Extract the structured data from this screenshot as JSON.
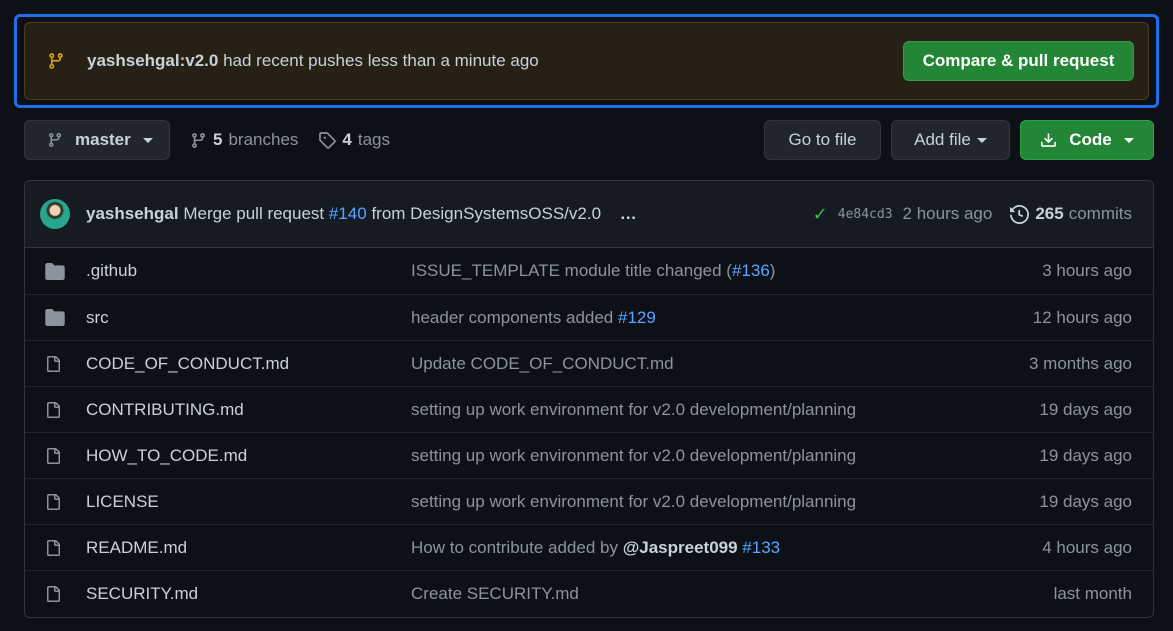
{
  "banner": {
    "branch": "yashsehgal:v2.0",
    "message": "had recent pushes less than a minute ago",
    "button": "Compare & pull request"
  },
  "toolbar": {
    "branch": "master",
    "branches_count": "5",
    "branches_label": "branches",
    "tags_count": "4",
    "tags_label": "tags",
    "goto_file": "Go to file",
    "add_file": "Add file",
    "code": "Code"
  },
  "commit": {
    "author": "yashsehgal",
    "msg_pre": "Merge pull request",
    "pr": "#140",
    "msg_post": "from DesignSystemsOSS/v2.0",
    "more": "…",
    "sha": "4e84cd3",
    "time": "2 hours ago",
    "commits_count": "265",
    "commits_label": "commits"
  },
  "files": [
    {
      "name": ".github",
      "type": "folder",
      "msg": "ISSUE_TEMPLATE module title changed (",
      "ref": "#136",
      "msg_end": ")",
      "age": "3 hours ago"
    },
    {
      "name": "src",
      "type": "folder",
      "msg": "header components added ",
      "ref": "#129",
      "msg_end": "",
      "age": "12 hours ago"
    },
    {
      "name": "CODE_OF_CONDUCT.md",
      "type": "file",
      "msg": "Update CODE_OF_CONDUCT.md",
      "ref": "",
      "msg_end": "",
      "age": "3 months ago"
    },
    {
      "name": "CONTRIBUTING.md",
      "type": "file",
      "msg": "setting up work environment for v2.0 development/planning",
      "ref": "",
      "msg_end": "",
      "age": "19 days ago"
    },
    {
      "name": "HOW_TO_CODE.md",
      "type": "file",
      "msg": "setting up work environment for v2.0 development/planning",
      "ref": "",
      "msg_end": "",
      "age": "19 days ago"
    },
    {
      "name": "LICENSE",
      "type": "file",
      "msg": "setting up work environment for v2.0 development/planning",
      "ref": "",
      "msg_end": "",
      "age": "19 days ago"
    },
    {
      "name": "README.md",
      "type": "file",
      "msg": "How to contribute added by ",
      "mention": "@Jaspreet099",
      "ref": "#133",
      "msg_end": "",
      "age": "4 hours ago"
    },
    {
      "name": "SECURITY.md",
      "type": "file",
      "msg": "Create SECURITY.md",
      "ref": "",
      "msg_end": "",
      "age": "last month"
    }
  ],
  "colors": {
    "background": "#0d1117",
    "accent_green": "#238636",
    "link_blue": "#58a6ff",
    "focus_ring": "#1f6feb"
  },
  "icons": {
    "banner": "git-branch-icon",
    "branch": "git-branch-icon",
    "tags": "tag-icon",
    "code": "download-icon",
    "history": "history-icon",
    "status": "check-icon",
    "folder": "folder-icon",
    "file": "file-icon"
  }
}
